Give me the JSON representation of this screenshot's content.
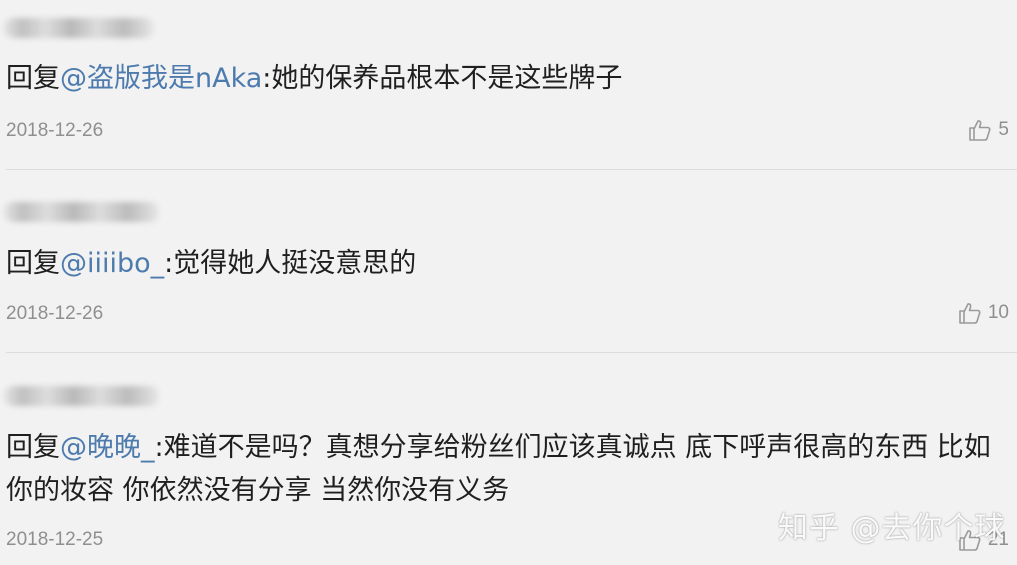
{
  "comments": [
    {
      "reply_prefix": "回复",
      "mention": "@盗版我是nAka",
      "separator": ":",
      "text": "她的保养品根本不是这些牌子",
      "date": "2018-12-26",
      "likes": "5"
    },
    {
      "reply_prefix": "回复",
      "mention": "@iiiibo_",
      "separator": ":",
      "text": "觉得她人挺没意思的",
      "date": "2018-12-26",
      "likes": "10"
    },
    {
      "reply_prefix": "回复",
      "mention": "@晚晚_",
      "separator": ":",
      "text": "难道不是吗？真想分享给粉丝们应该真诚点 底下呼声很高的东西 比如你的妆容 你依然没有分享 当然你没有义务",
      "date": "2018-12-25",
      "likes": "21"
    }
  ],
  "watermark": "知乎 @去你个球",
  "icons": {
    "like": "thumbs-up-icon"
  },
  "colors": {
    "background": "#f2f2f2",
    "mention": "#4d7bae",
    "meta_text": "#8f8f8f",
    "body_text": "#1f1f1f"
  }
}
